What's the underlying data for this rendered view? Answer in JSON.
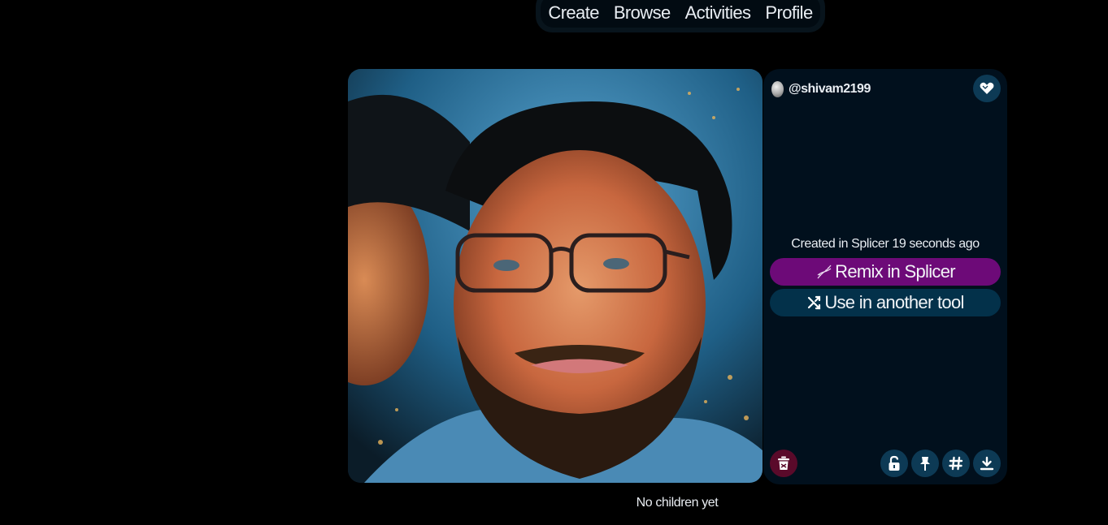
{
  "nav": {
    "items": [
      {
        "label": "Create"
      },
      {
        "label": "Browse"
      },
      {
        "label": "Activities"
      },
      {
        "label": "Profile"
      }
    ]
  },
  "image": {
    "icon": "portrait-image"
  },
  "panel": {
    "username": "@shivam2199",
    "like_icon": "heart-icon",
    "created_text": "Created in Splicer 19 seconds ago",
    "remix_label": "Remix in Splicer",
    "remix_icon": "dna-icon",
    "tool_label": "Use in another tool",
    "tool_icon": "shuffle-icon",
    "actions": [
      "delete-icon",
      "unlock-icon",
      "pin-icon",
      "hashtag-icon",
      "download-icon"
    ]
  },
  "footer": {
    "caption": "No children yet"
  },
  "colors": {
    "page_bg": "#000000",
    "panel_bg": "#01101d",
    "remix_bg": "#6d0a78",
    "tool_bg": "#03314a",
    "round_bg": "#0d3a55",
    "delete_bg": "#5a0a2a"
  }
}
